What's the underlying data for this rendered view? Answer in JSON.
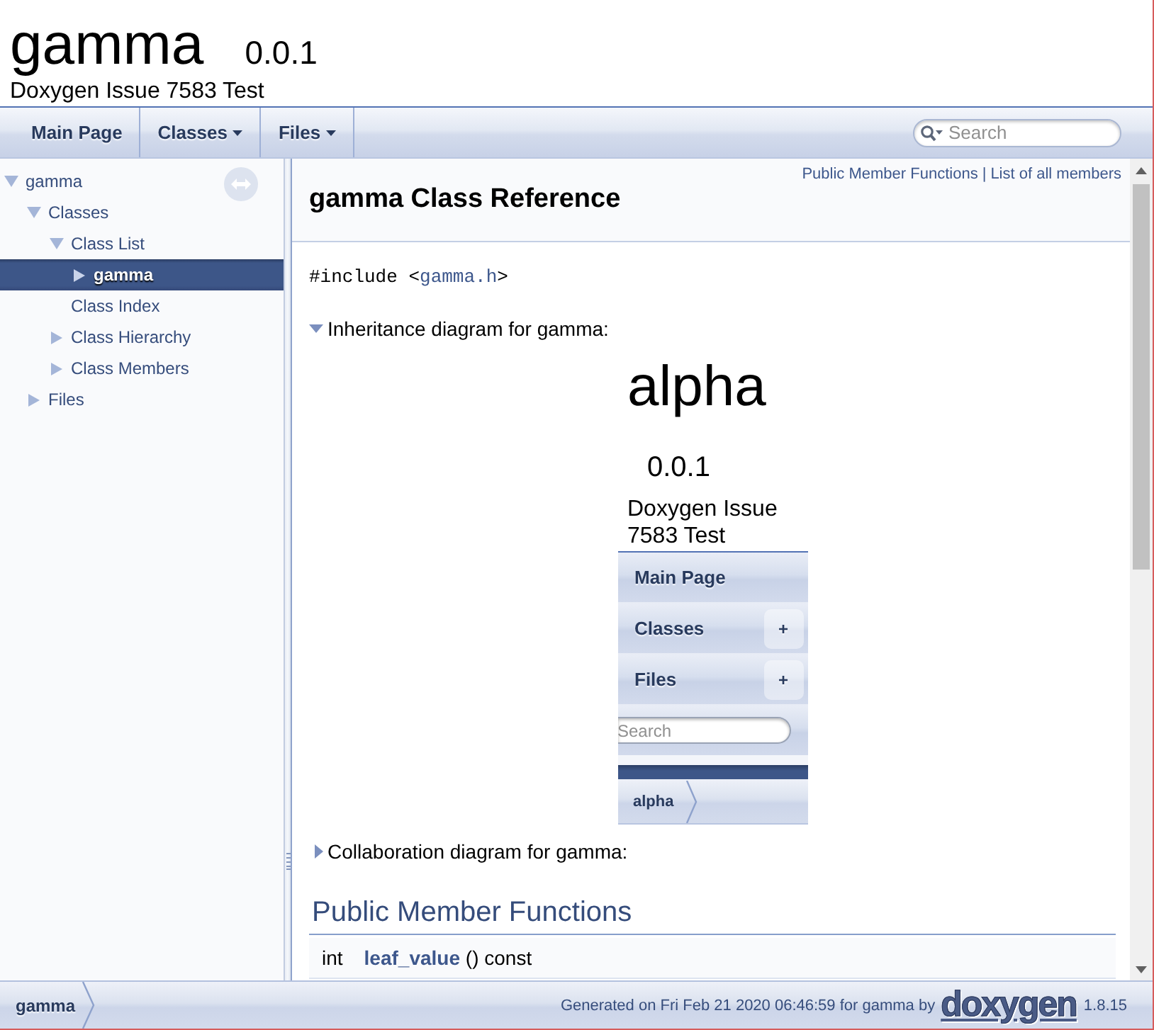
{
  "header": {
    "project_name": "gamma",
    "project_number": "0.0.1",
    "project_brief": "Doxygen Issue 7583 Test"
  },
  "navbar": {
    "tabs": [
      {
        "label": "Main Page",
        "has_menu": false
      },
      {
        "label": "Classes",
        "has_menu": true
      },
      {
        "label": "Files",
        "has_menu": true
      }
    ],
    "search": {
      "placeholder": "Search"
    }
  },
  "nav_tree": {
    "items": [
      {
        "label": "gamma",
        "expanded": true,
        "selected": false,
        "children": [
          {
            "label": "Classes",
            "expanded": true,
            "selected": false,
            "children": [
              {
                "label": "Class List",
                "expanded": true,
                "selected": false,
                "children": [
                  {
                    "label": "gamma",
                    "expanded": false,
                    "selected": true
                  }
                ]
              },
              {
                "label": "Class Index",
                "selected": false
              },
              {
                "label": "Class Hierarchy",
                "expanded": false,
                "selected": false
              },
              {
                "label": "Class Members",
                "expanded": false,
                "selected": false
              }
            ]
          },
          {
            "label": "Files",
            "expanded": false,
            "selected": false
          }
        ]
      }
    ]
  },
  "content": {
    "summary_links": [
      "Public Member Functions",
      "List of all members"
    ],
    "summary_separator": "|",
    "title": "gamma Class Reference",
    "include": {
      "prefix": "#include <",
      "file": "gamma.h",
      "suffix": ">"
    },
    "diagrams": [
      {
        "label": "Inheritance diagram for gamma:",
        "expanded": true,
        "preview": {
          "project_name": "alpha",
          "project_number": "0.0.1",
          "project_brief": "Doxygen Issue 7583 Test",
          "menu": [
            {
              "label": "Main Page"
            },
            {
              "label": "Classes",
              "submenu_toggle": "+"
            },
            {
              "label": "Files",
              "submenu_toggle": "+"
            }
          ],
          "search": {
            "placeholder": "Search"
          },
          "breadcrumb": "alpha"
        }
      },
      {
        "label": "Collaboration diagram for gamma:",
        "expanded": false
      }
    ],
    "sections": [
      {
        "heading": "Public Member Functions",
        "members": [
          {
            "type": "int",
            "name": "leaf_value",
            "args": "() const"
          }
        ]
      }
    ]
  },
  "footer": {
    "breadcrumb": "gamma",
    "generated": "Generated on Fri Feb 21 2020 06:46:59 for gamma by",
    "logo": "doxygen",
    "version": "1.8.15"
  }
}
